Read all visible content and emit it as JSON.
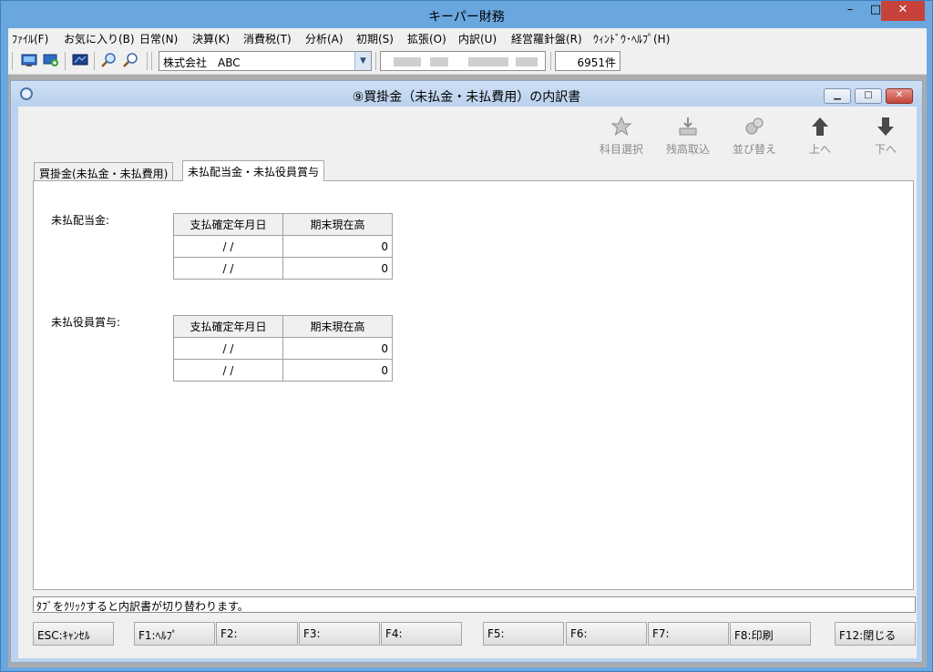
{
  "window": {
    "title": "キーパー財務",
    "min": "–",
    "max": "□",
    "close": "✕"
  },
  "menu": [
    "ﾌｧｲﾙ(F)",
    "お気に入り(B)",
    "日常(N)",
    "決算(K)",
    "消費税(T)",
    "分析(A)",
    "初期(S)",
    "拡張(O)",
    "内訳(U)",
    "経営羅針盤(R)",
    "ｳｨﾝﾄﾞｳ･ﾍﾙﾌﾟ(H)"
  ],
  "toolbar": {
    "company": "株式会社　ABC",
    "dropdown_arrow": "▼",
    "count": "6951件"
  },
  "child": {
    "title": "⑨買掛金（未払金・未払費用）の内訳書",
    "min": "▁",
    "max": "□",
    "close": "✕"
  },
  "actions": [
    {
      "label": "科目選択",
      "icon": "star-icon"
    },
    {
      "label": "残高取込",
      "icon": "import-icon"
    },
    {
      "label": "並び替え",
      "icon": "sort-icon"
    },
    {
      "label": "上へ",
      "icon": "arrow-up-icon"
    },
    {
      "label": "下へ",
      "icon": "arrow-down-icon"
    }
  ],
  "tabs": [
    "買掛金(未払金・未払費用)",
    "未払配当金・未払役員賞与"
  ],
  "section1": {
    "label": "未払配当金:",
    "headers": [
      "支払確定年月日",
      "期末現在高"
    ],
    "rows": [
      [
        "/ /",
        "0"
      ],
      [
        "/ /",
        "0"
      ]
    ]
  },
  "section2": {
    "label": "未払役員賞与:",
    "headers": [
      "支払確定年月日",
      "期末現在高"
    ],
    "rows": [
      [
        "/ /",
        "0"
      ],
      [
        "/ /",
        "0"
      ]
    ]
  },
  "status": "ﾀﾌﾞをｸﾘｯｸすると内訳書が切り替わります。",
  "fkeys": [
    "ESC:ｷｬﾝｾﾙ",
    "F1:ﾍﾙﾌﾟ",
    "F2:",
    "F3:",
    "F4:",
    "F5:",
    "F6:",
    "F7:",
    "F8:印刷",
    "F12:閉じる"
  ]
}
